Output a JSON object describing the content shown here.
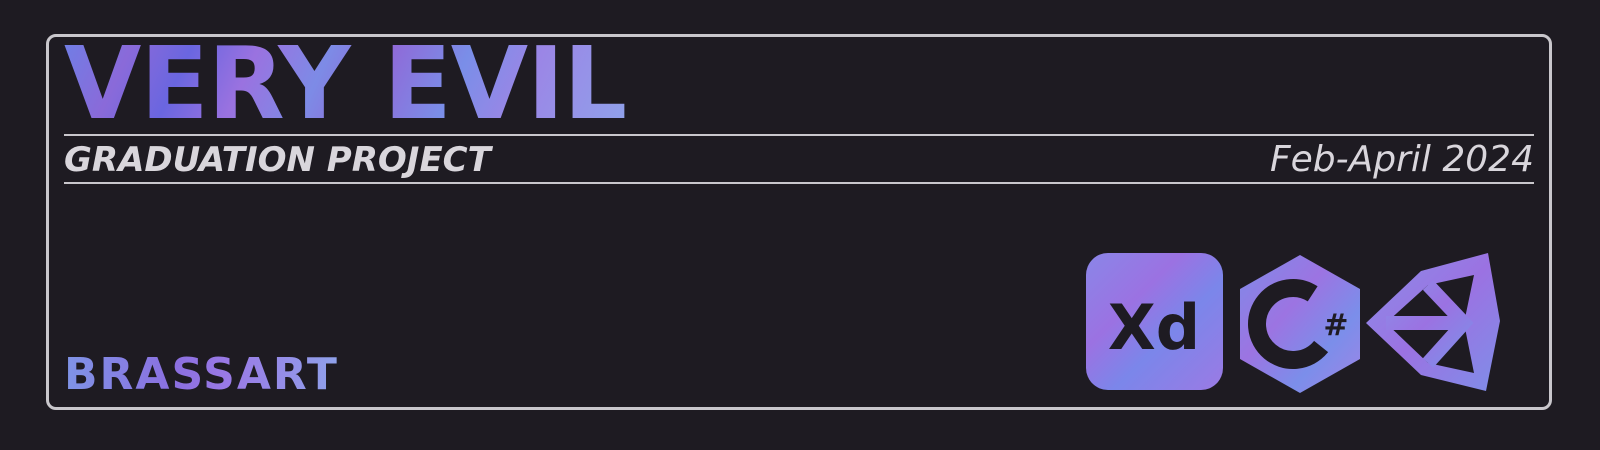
{
  "card": {
    "title": "VERY EVIL",
    "subtitle": "GRADUATION PROJECT",
    "date": "Feb-April 2024",
    "brand": "BRASSART"
  },
  "tools": [
    {
      "name": "xd-icon",
      "label": "Xd"
    },
    {
      "name": "csharp-icon",
      "label": "C#"
    },
    {
      "name": "unity-icon",
      "label": ""
    }
  ],
  "colors": {
    "background": "#1e1b22",
    "border": "#c9c7cc",
    "text_light": "#d9d6dc",
    "gradient_blue": "#7f94e6",
    "gradient_purple": "#8b6fe0"
  }
}
